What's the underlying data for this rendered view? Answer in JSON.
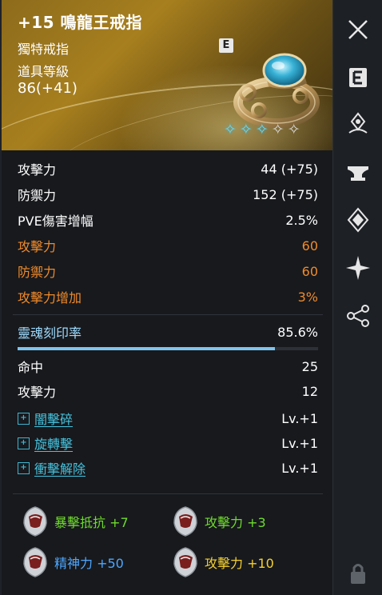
{
  "item": {
    "title": "+15 鳴龍王戒指",
    "grade": "獨特戒指",
    "level_label": "道具等級",
    "level": "86(+41)",
    "badge": "E",
    "star_total": 5,
    "star_filled": 3
  },
  "base_stats": [
    {
      "label": "攻擊力",
      "value": "44 (+75)"
    },
    {
      "label": "防禦力",
      "value": "152 (+75)"
    },
    {
      "label": "PVE傷害增幅",
      "value": "2.5%"
    }
  ],
  "bonus_stats": [
    {
      "label": "攻擊力",
      "value": "60"
    },
    {
      "label": "防禦力",
      "value": "60"
    },
    {
      "label": "攻擊力增加",
      "value": "3%"
    }
  ],
  "soul": {
    "label": "靈魂刻印率",
    "value": "85.6%",
    "progress": 0.856
  },
  "soul_stats": [
    {
      "label": "命中",
      "value": "25"
    },
    {
      "label": "攻擊力",
      "value": "12"
    }
  ],
  "skills": [
    {
      "name": "闇擊碎",
      "level": "Lv.+1"
    },
    {
      "name": "旋轉擊",
      "level": "Lv.+1"
    },
    {
      "name": "衝擊解除",
      "level": "Lv.+1"
    }
  ],
  "engravings": [
    {
      "text": "暴擊抵抗 +7",
      "color": "#6fdc2d"
    },
    {
      "text": "攻擊力 +3",
      "color": "#6fdc2d"
    },
    {
      "text": "精神力 +50",
      "color": "#4ea7ff"
    },
    {
      "text": "攻擊力 +10",
      "color": "#f6d12e"
    }
  ],
  "colors": {
    "header_gold": "#a77f1e",
    "bonus_orange": "#f08a2a",
    "soul_bar": "#7fc4ee",
    "skill_cyan": "#45c3de"
  },
  "sidebar_icons": [
    "close-icon",
    "e-badge-icon",
    "location-pin-icon",
    "anvil-icon",
    "diamond-crest-icon",
    "sparkle-star-icon",
    "share-icon",
    "lock-icon"
  ]
}
